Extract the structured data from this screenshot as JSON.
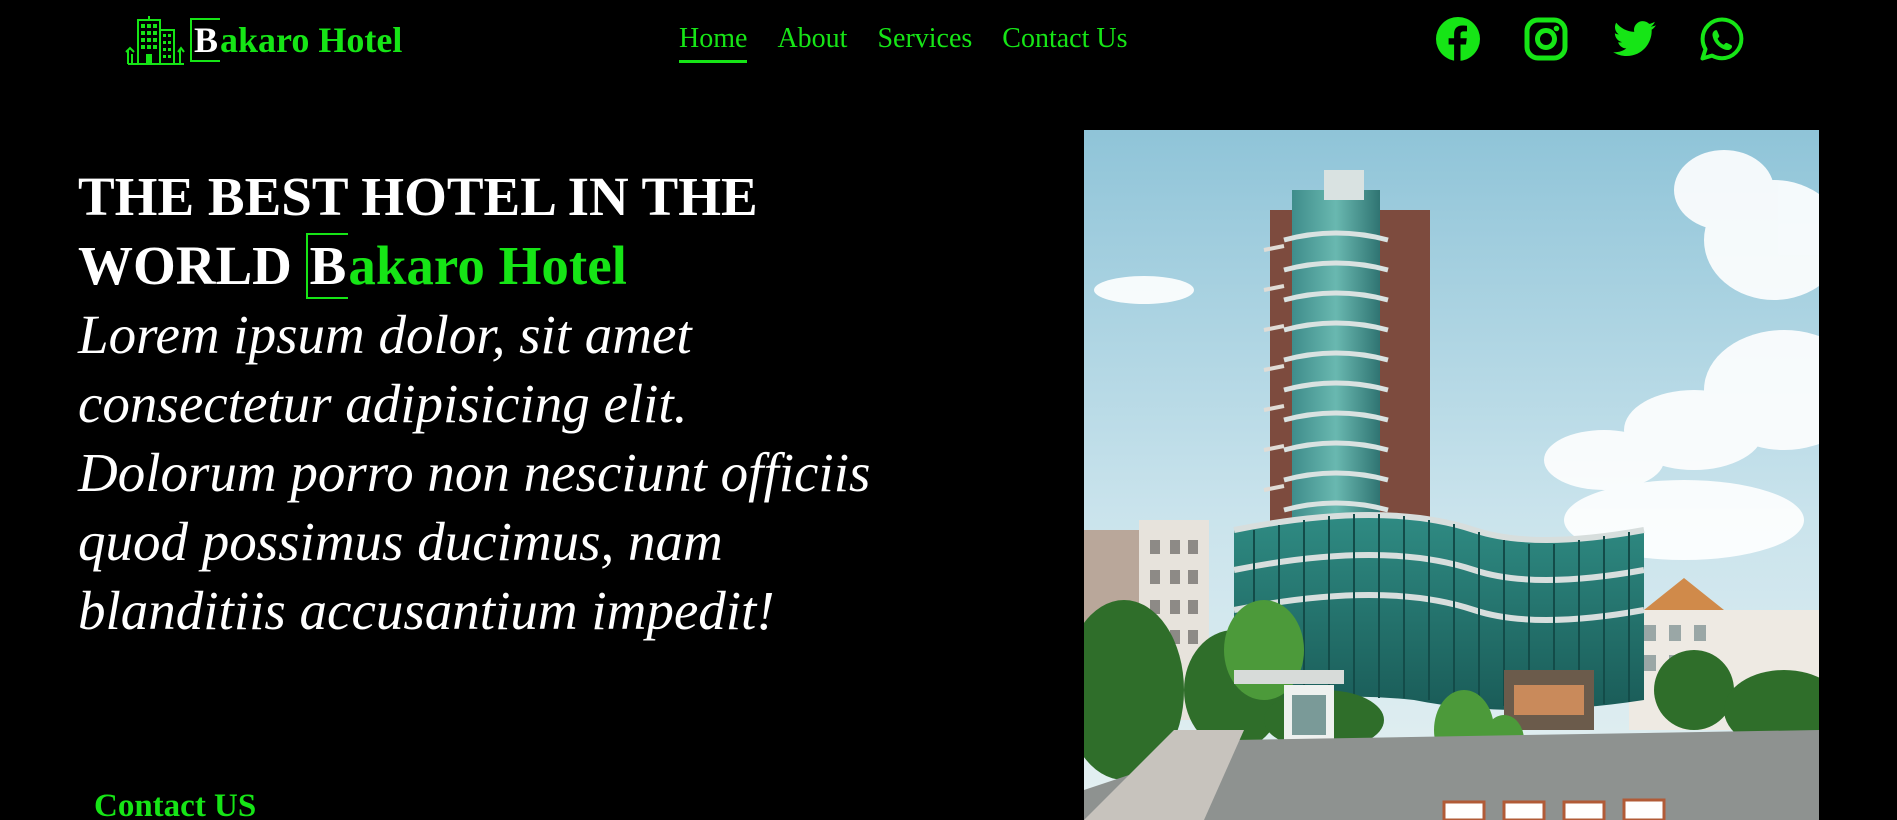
{
  "nav": {
    "brand": {
      "icon": "hotel-building-icon",
      "initial": "B",
      "rest": "akaro Hotel"
    },
    "links": [
      {
        "label": "Home",
        "active": true
      },
      {
        "label": "About",
        "active": false
      },
      {
        "label": "Services",
        "active": false
      },
      {
        "label": "Contact Us",
        "active": false
      }
    ],
    "social_icons": [
      "facebook-icon",
      "instagram-icon",
      "twitter-icon",
      "whatsapp-icon"
    ]
  },
  "hero": {
    "title_prefix": "THE BEST HOTEL IN THE WORLD",
    "brand_initial": "B",
    "brand_rest": "akaro Hotel",
    "description": "Lorem ipsum dolor, sit amet consectetur adipisicing elit. Dolorum porro non nesciunt officiis quod possimus ducimus, nam blanditiis accusantium impedit!",
    "cta_label": "Contact US",
    "image": "hotel-tower-photo"
  },
  "colors": {
    "background": "#000000",
    "accent": "#16e516",
    "text": "#ffffff"
  }
}
